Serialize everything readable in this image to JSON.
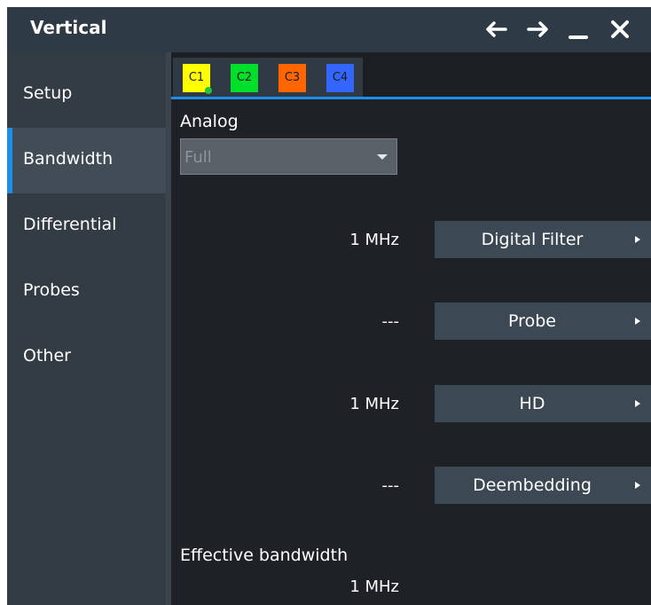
{
  "window": {
    "title": "Vertical",
    "controls": [
      "back-arrow-icon",
      "forward-arrow-icon",
      "minimize-icon",
      "close-icon"
    ]
  },
  "sidebar": {
    "items": [
      {
        "label": "Setup",
        "active": false
      },
      {
        "label": "Bandwidth",
        "active": true
      },
      {
        "label": "Differential",
        "active": false
      },
      {
        "label": "Probes",
        "active": false
      },
      {
        "label": "Other",
        "active": false
      }
    ]
  },
  "tabs": [
    {
      "label": "C1",
      "color": "#ffff00",
      "selected": true
    },
    {
      "label": "C2",
      "color": "#00e02a"
    },
    {
      "label": "C3",
      "color": "#ff6600"
    },
    {
      "label": "C4",
      "color": "#3366ff"
    }
  ],
  "analog": {
    "label": "Analog",
    "value": "Full"
  },
  "rows": [
    {
      "value": "1 MHz",
      "button": "Digital Filter"
    },
    {
      "value": "---",
      "button": "Probe"
    },
    {
      "value": "1 MHz",
      "button": "HD"
    },
    {
      "value": "---",
      "button": "Deembedding"
    }
  ],
  "effective": {
    "label": "Effective bandwidth",
    "value": "1 MHz"
  },
  "colors": {
    "accent": "#1e8ee9"
  }
}
